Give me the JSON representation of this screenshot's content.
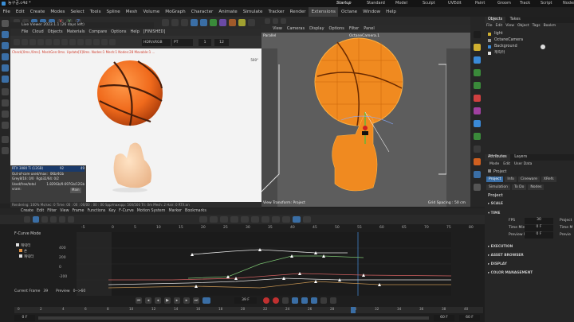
{
  "app": {
    "title": "농구공.c4d *",
    "layouts": [
      "Startup",
      "Standard",
      "Model",
      "Sculpt",
      "UVEdit",
      "Paint",
      "Groom",
      "Track",
      "Script",
      "Nodes"
    ],
    "active_layout": "Startup"
  },
  "menu": [
    "File",
    "Edit",
    "Create",
    "Modes",
    "Select",
    "Tools",
    "Spline",
    "Mesh",
    "Volume",
    "MoGraph",
    "Character",
    "Animate",
    "Simulate",
    "Tracker",
    "Render",
    "Extensions",
    "Octane",
    "Window",
    "Help"
  ],
  "live_viewer": {
    "title": "Live Viewer 2023.1.1 (26 days left)",
    "menu": [
      "File",
      "Cloud",
      "Objects",
      "Materials",
      "Compare",
      "Options",
      "Help",
      "[FINISHED]"
    ],
    "mode": "HDR/sRGB",
    "pt": "PT",
    "num1": "1",
    "num2": "12",
    "status_text": "Check[0ms./0ms]. MeshGen:0ms. Update[0]0ms. Nodes:1 Mesh:1 Nodes:28 Movable:1 ...",
    "zoom_readout": "500°",
    "gpu_rows": [
      {
        "label": "RTX 3080 Ti (12GB)",
        "v1": "92",
        "v2": "49"
      },
      {
        "label": "Out-of-core used/max:",
        "v1": "0Kb/4Gb"
      },
      {
        "label": "Grey8/16: 0/0",
        "v1": "Rgb32/64: 0/2"
      },
      {
        "label": "Used/free/total vram:",
        "v1": "1.829Gb/9.697Gb/12Gb"
      }
    ],
    "render_badge": "Rendering: 100% Ms/sec: 0  Time: 00 : 00 : 00/00 : 00 : 00  Spp/maxspp: 500/500  Tri: 0m  Mesh: 2  Hair: 0  RTX:on",
    "main_tag": "Main"
  },
  "viewport": {
    "menu": [
      "View",
      "Cameras",
      "Display",
      "Options",
      "Filter",
      "Panel"
    ],
    "camera_label": "Parallel",
    "camera_name": "OctaneCamera.1",
    "rotate_label": "Rotate :",
    "bottom_left": "View Transform: Project",
    "grid_spacing": "Grid Spacing : 50 cm"
  },
  "objects_panel": {
    "tabs": [
      "Objects",
      "Takes"
    ],
    "menu": [
      "File",
      "Edit",
      "View",
      "Object",
      "Tags",
      "Bookm"
    ],
    "items": [
      {
        "name": "light"
      },
      {
        "name": "OctaneCamera"
      },
      {
        "name": "Background"
      },
      {
        "name": "캐릭터"
      }
    ]
  },
  "attributes_panel": {
    "tabs": [
      "Attributes",
      "Layers"
    ],
    "menu": [
      "Mode",
      "Edit",
      "User Data"
    ],
    "title": "Project",
    "subtabs": [
      "Project",
      "Info",
      "Cineware",
      "XRefs"
    ],
    "subtabs2": [
      "Simulation",
      "To Do",
      "Nodes"
    ],
    "section": "Project",
    "groups": [
      "SCALE",
      "TIME",
      "EXECUTION",
      "ASSET BROWSER",
      "DISPLAY",
      "COLOR MANAGEMENT"
    ],
    "time_fields": [
      {
        "label": "FPS",
        "value": "30",
        "extra": "Project"
      },
      {
        "label": "Time Min",
        "value": "0 F",
        "extra": "Time M"
      },
      {
        "label": "Preview Min",
        "value": "0 F",
        "extra": "Previe"
      }
    ]
  },
  "timeline": {
    "menu": [
      "Create",
      "Edit",
      "Filter",
      "View",
      "Frame",
      "Functions",
      "Key",
      "F-Curve",
      "Motion System",
      "Marker",
      "Bookmarks"
    ],
    "title": "F-Curve Mode",
    "ruler": [
      "-5",
      "0",
      "5",
      "10",
      "15",
      "20",
      "25",
      "30",
      "35",
      "40",
      "45",
      "50",
      "55",
      "60",
      "65",
      "70",
      "75",
      "80"
    ],
    "bottom_ruler": [
      "0",
      "2",
      "4",
      "6",
      "8",
      "10",
      "12",
      "14",
      "16",
      "18",
      "20",
      "22",
      "24",
      "26",
      "28",
      "30",
      "32",
      "34",
      "36",
      "38",
      "40"
    ],
    "y_labels": [
      "400",
      "200",
      "0",
      "-200"
    ],
    "tracks": [
      "캐릭터",
      "손",
      "캐릭터"
    ],
    "current_frame_label": "Current Frame",
    "current_frame": "39",
    "preview_label": "Preview",
    "preview_range": "0-->60",
    "frame_field": "39 F",
    "end_field1": "60 F",
    "end_field2": "60 F",
    "start_field": "0 F"
  }
}
